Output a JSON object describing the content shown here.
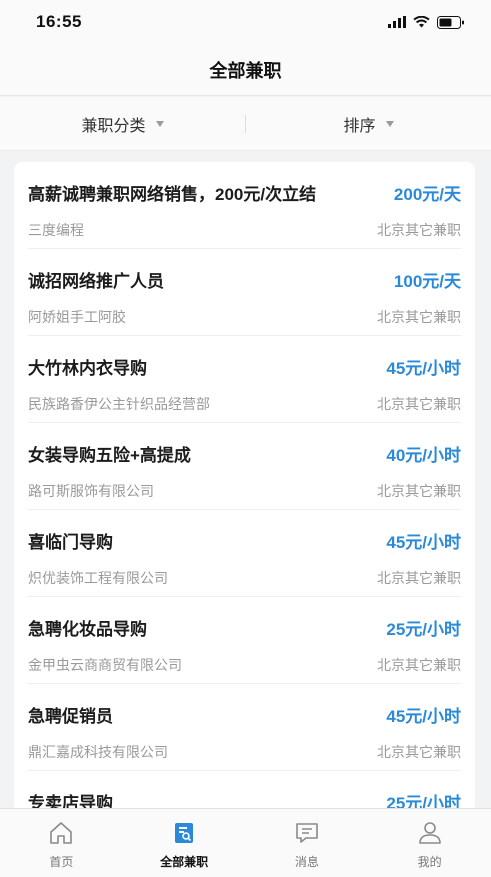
{
  "status_bar": {
    "time": "16:55"
  },
  "nav": {
    "title": "全部兼职"
  },
  "filters": [
    {
      "label": "兼职分类"
    },
    {
      "label": "排序"
    }
  ],
  "jobs": [
    {
      "title": "高薪诚聘兼职网络销售，200元/次立结",
      "salary": "200元/天",
      "company": "三度编程",
      "location": "北京其它兼职"
    },
    {
      "title": "诚招网络推广人员",
      "salary": "100元/天",
      "company": "阿娇姐手工阿胶",
      "location": "北京其它兼职"
    },
    {
      "title": "大竹林内衣导购",
      "salary": "45元/小时",
      "company": "民族路香伊公主针织品经营部",
      "location": "北京其它兼职"
    },
    {
      "title": "女装导购五险+高提成",
      "salary": "40元/小时",
      "company": "路可斯服饰有限公司",
      "location": "北京其它兼职"
    },
    {
      "title": "喜临门导购",
      "salary": "45元/小时",
      "company": "炽优装饰工程有限公司",
      "location": "北京其它兼职"
    },
    {
      "title": "急聘化妆品导购",
      "salary": "25元/小时",
      "company": "金甲虫云商商贸有限公司",
      "location": "北京其它兼职"
    },
    {
      "title": "急聘促销员",
      "salary": "45元/小时",
      "company": "鼎汇嘉成科技有限公司",
      "location": "北京其它兼职"
    },
    {
      "title": "专卖店导购",
      "salary": "25元/小时",
      "company": "",
      "location": ""
    }
  ],
  "tabs": [
    {
      "label": "首页",
      "icon": "home-icon"
    },
    {
      "label": "全部兼职",
      "icon": "job-search-icon",
      "active": true
    },
    {
      "label": "消息",
      "icon": "message-icon"
    },
    {
      "label": "我的",
      "icon": "profile-icon"
    }
  ],
  "colors": {
    "accent": "#2a8ad9",
    "salary": "#2a8ad9"
  }
}
